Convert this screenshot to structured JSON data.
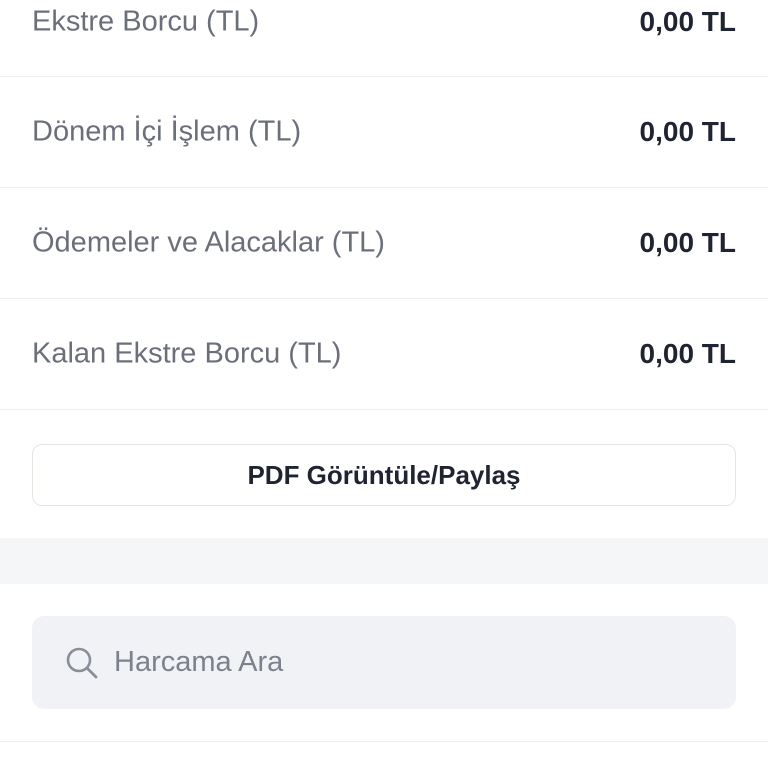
{
  "summary": {
    "rows": [
      {
        "label": "Ekstre Borcu (TL)",
        "value": "0,00 TL"
      },
      {
        "label": "Dönem İçi İşlem (TL)",
        "value": "0,00 TL"
      },
      {
        "label": "Ödemeler ve Alacaklar (TL)",
        "value": "0,00 TL"
      },
      {
        "label": "Kalan Ekstre Borcu (TL)",
        "value": "0,00 TL"
      }
    ]
  },
  "actions": {
    "pdf_label": "PDF Görüntüle/Paylaş"
  },
  "search": {
    "placeholder": "Harcama Ara",
    "value": "",
    "icon": "search-icon"
  },
  "colors": {
    "label_text": "#6b6f7b",
    "value_text": "#1f2433",
    "divider": "#eceef2",
    "search_bg": "#f0f2f6",
    "band_bg": "#f5f6f8"
  }
}
